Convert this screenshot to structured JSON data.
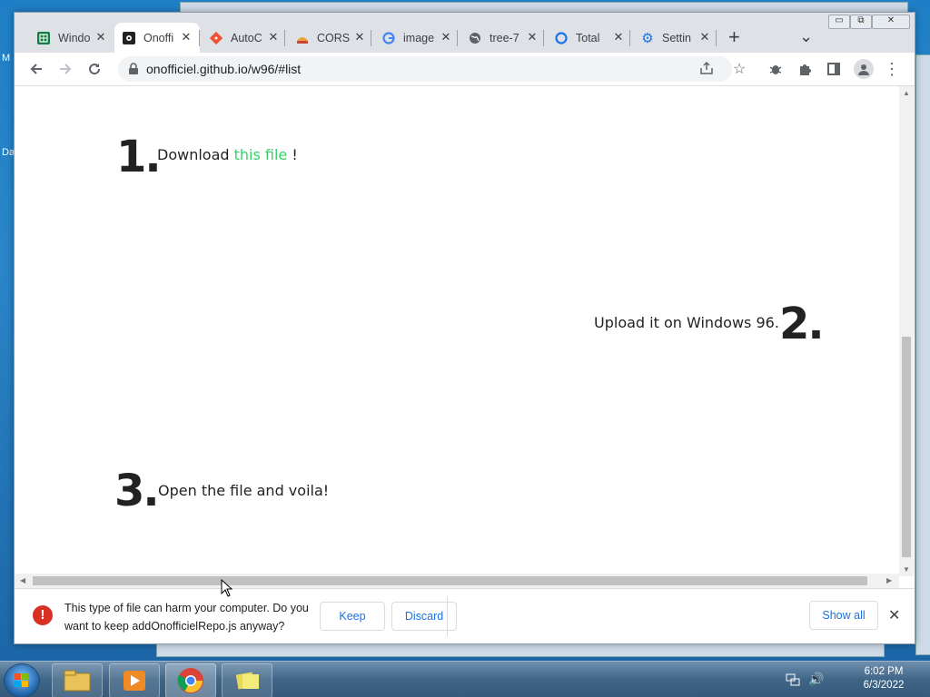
{
  "desktop": {
    "label_m": "M",
    "label_da": "Da"
  },
  "window_controls": {
    "minimize": "▭",
    "restore": "⧉",
    "close": "✕"
  },
  "tabs": [
    {
      "title": "Windo",
      "icon": "spreadsheet-icon",
      "active": false
    },
    {
      "title": "Onoffi",
      "icon": "onofficiel-icon",
      "active": true
    },
    {
      "title": "AutoC",
      "icon": "git-icon",
      "active": false
    },
    {
      "title": "CORS",
      "icon": "cors-icon",
      "active": false
    },
    {
      "title": "image",
      "icon": "google-icon",
      "active": false
    },
    {
      "title": "tree-7",
      "icon": "globe-icon",
      "active": false
    },
    {
      "title": "Total",
      "icon": "circle-icon",
      "active": false
    },
    {
      "title": "Settin",
      "icon": "gear-icon",
      "active": false
    }
  ],
  "new_tab": "+",
  "tab_menu": "⌄",
  "address": {
    "url": "onofficiel.github.io/w96/#list"
  },
  "steps": [
    {
      "number": "1.",
      "text_before": "Download ",
      "link": "this file",
      "text_after": " !"
    },
    {
      "number": "2.",
      "text": "Upload it on Windows 96."
    },
    {
      "number": "3.",
      "text": "Open the file and voila!"
    }
  ],
  "download": {
    "warning_icon": "!",
    "message": "This type of file can harm your computer. Do you want to keep addOnofficielRepo.js anyway?",
    "keep": "Keep",
    "discard": "Discard",
    "show_all": "Show all",
    "close": "✕"
  },
  "tray": {
    "time": "6:02 PM",
    "date": "6/3/2022"
  }
}
